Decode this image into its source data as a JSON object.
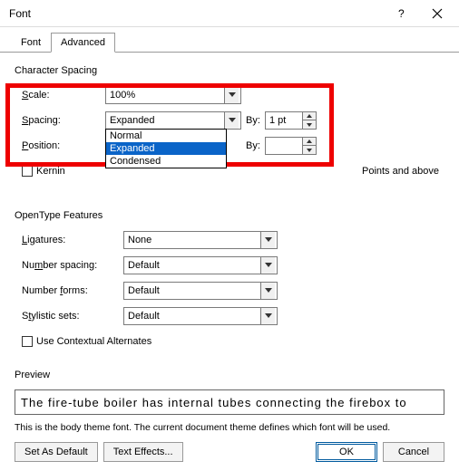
{
  "window": {
    "title": "Font"
  },
  "tabs": {
    "font": "Font",
    "advanced": "Advanced"
  },
  "character_spacing": {
    "header": "Character Spacing",
    "scale": {
      "label": "Scale:",
      "value": "100%"
    },
    "spacing": {
      "label": "Spacing:",
      "value": "Expanded",
      "by_label": "By:",
      "by_value": "1 pt",
      "options": {
        "normal": "Normal",
        "expanded": "Expanded",
        "condensed": "Condensed"
      }
    },
    "position": {
      "label": "Position:",
      "value": "",
      "by_label": "By:",
      "by_value": ""
    },
    "kerning": {
      "label": "Kerning",
      "suffix": "Points and above"
    }
  },
  "opentype": {
    "header": "OpenType Features",
    "ligatures": {
      "label": "Ligatures:",
      "value": "None"
    },
    "number_spacing": {
      "label": "Number spacing:",
      "value": "Default"
    },
    "number_forms": {
      "label": "Number forms:",
      "value": "Default"
    },
    "stylistic_sets": {
      "label": "Stylistic sets:",
      "value": "Default"
    },
    "contextual": "Use Contextual Alternates"
  },
  "preview": {
    "header": "Preview",
    "text": "The fire-tube boiler has internal tubes connecting the firebox to",
    "hint": "This is the body theme font. The current document theme defines which font will be used."
  },
  "footer": {
    "set_default": "Set As Default",
    "text_effects": "Text Effects...",
    "ok": "OK",
    "cancel": "Cancel"
  }
}
